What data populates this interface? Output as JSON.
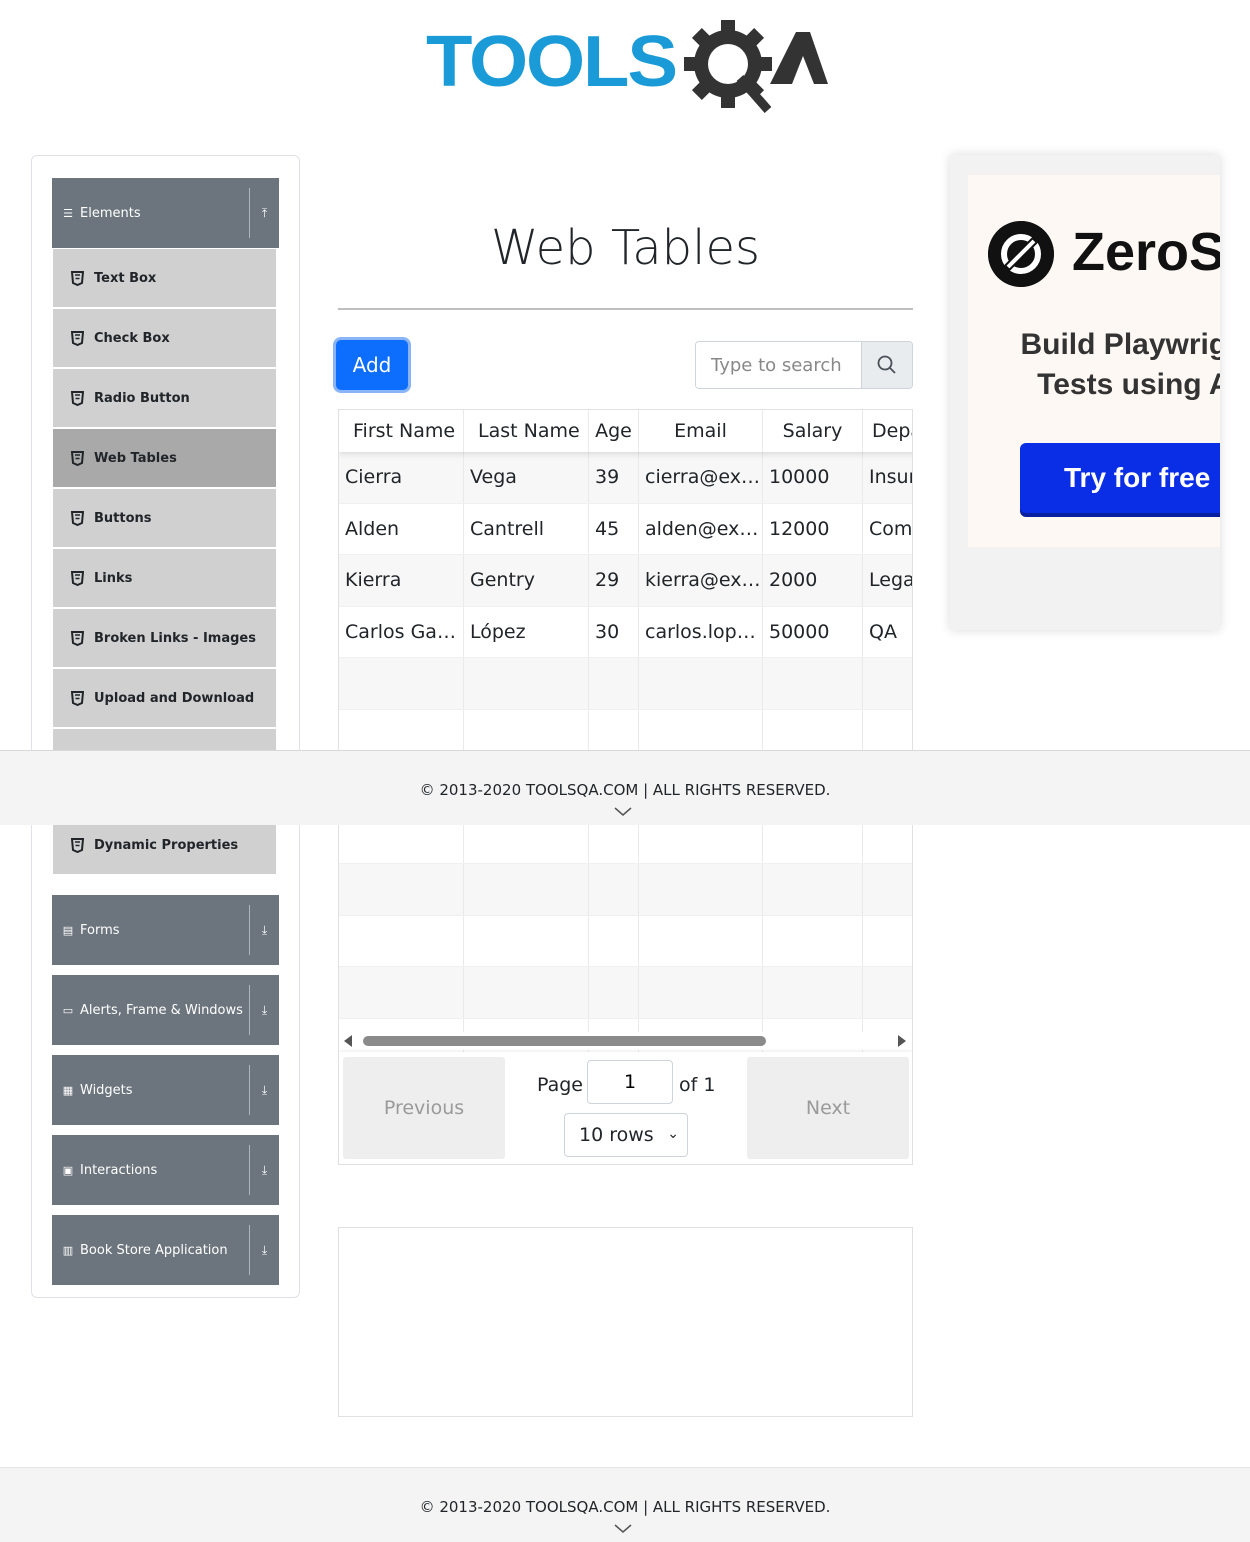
{
  "header": {
    "logo_text": "TOOLSQA"
  },
  "sidebar": {
    "groups": [
      {
        "label": "Elements",
        "icon": "hamburger-icon",
        "toggle": "collapse-up-icon"
      },
      {
        "label": "Forms",
        "icon": "form-icon",
        "toggle": "expand-down-icon"
      },
      {
        "label": "Alerts, Frame & Windows",
        "icon": "window-icon",
        "toggle": "expand-down-icon"
      },
      {
        "label": "Widgets",
        "icon": "grid-icon",
        "toggle": "expand-down-icon"
      },
      {
        "label": "Interactions",
        "icon": "interaction-icon",
        "toggle": "expand-down-icon"
      },
      {
        "label": "Book Store Application",
        "icon": "books-icon",
        "toggle": "expand-down-icon"
      }
    ],
    "items": [
      {
        "label": "Text Box"
      },
      {
        "label": "Check Box"
      },
      {
        "label": "Radio Button"
      },
      {
        "label": "Web Tables",
        "active": true
      },
      {
        "label": "Buttons"
      },
      {
        "label": "Links"
      },
      {
        "label": "Broken Links - Images"
      },
      {
        "label": "Upload and Download"
      },
      {
        "label": "Dynamic Properties"
      }
    ]
  },
  "main": {
    "title": "Web Tables",
    "add_label": "Add",
    "search_placeholder": "Type to search",
    "table": {
      "headers": [
        "First Name",
        "Last Name",
        "Age",
        "Email",
        "Salary",
        "Department"
      ],
      "rows": [
        [
          "Cierra",
          "Vega",
          "39",
          "cierra@example.com",
          "10000",
          "Insurance"
        ],
        [
          "Alden",
          "Cantrell",
          "45",
          "alden@example.com",
          "12000",
          "Compliance"
        ],
        [
          "Kierra",
          "Gentry",
          "29",
          "kierra@example.com",
          "2000",
          "Legal"
        ],
        [
          "Carlos García",
          "López",
          "30",
          "carlos.lopez@example.com",
          "50000",
          "QA"
        ]
      ],
      "empty_rows": 6
    },
    "pagination": {
      "previous": "Previous",
      "next": "Next",
      "page_label": "Page",
      "page_value": "1",
      "of_label": "of 1",
      "rows_select": "10 rows"
    }
  },
  "ad": {
    "brand": "ZeroStep",
    "headline_1": "Build Playwright",
    "headline_2": "Tests using AI",
    "cta": "Try for free →"
  },
  "footer": {
    "text": "© 2013-2020 TOOLSQA.COM | ALL RIGHTS RESERVED."
  },
  "colors": {
    "primary": "#0d6efd",
    "sidebar_header": "#6c757d",
    "menu_item": "#d0d0d0",
    "logo_blue": "#1a9bd7",
    "logo_dark": "#333333"
  }
}
